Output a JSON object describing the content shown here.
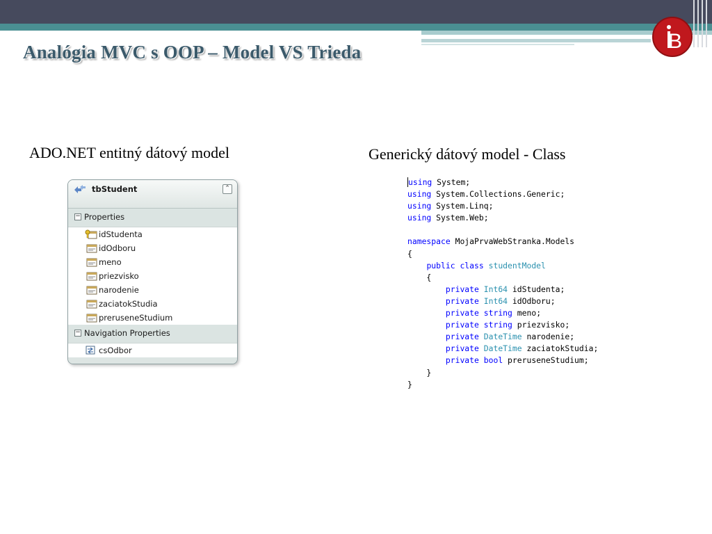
{
  "slide": {
    "title": "Analógia MVC s OOP – Model VS Trieda",
    "logo_letter": "B",
    "caption_left": "ADO.NET entitný dátový model",
    "caption_right": "Generický dátový model - Class"
  },
  "colors": {
    "header_dark": "#464a5d",
    "header_teal": "#4a8f92",
    "logo_red": "#c0181d",
    "title": "#3b5a6b",
    "code_keyword": "#0000ff",
    "code_type": "#2b91af"
  },
  "entity": {
    "name": "tbStudent",
    "collapse_glyph": "⌃",
    "sections": [
      {
        "title": "Properties",
        "items": [
          {
            "label": "idStudenta",
            "icon": "key-property-icon"
          },
          {
            "label": "idOdboru",
            "icon": "property-icon"
          },
          {
            "label": "meno",
            "icon": "property-icon"
          },
          {
            "label": "priezvisko",
            "icon": "property-icon"
          },
          {
            "label": "narodenie",
            "icon": "property-icon"
          },
          {
            "label": "zaciatokStudia",
            "icon": "property-icon"
          },
          {
            "label": "preruseneStudium",
            "icon": "property-icon"
          }
        ]
      },
      {
        "title": "Navigation Properties",
        "items": [
          {
            "label": "csOdbor",
            "icon": "navigation-property-icon"
          }
        ]
      }
    ]
  },
  "code": {
    "lines": [
      [
        [
          "kw",
          "using"
        ],
        [
          "t",
          " System;"
        ]
      ],
      [
        [
          "kw",
          "using"
        ],
        [
          "t",
          " System.Collections.Generic;"
        ]
      ],
      [
        [
          "kw",
          "using"
        ],
        [
          "t",
          " System.Linq;"
        ]
      ],
      [
        [
          "kw",
          "using"
        ],
        [
          "t",
          " System.Web;"
        ]
      ],
      [],
      [
        [
          "kw",
          "namespace"
        ],
        [
          "t",
          " MojaPrvaWebStranka.Models"
        ]
      ],
      [
        [
          "t",
          "{"
        ]
      ],
      [
        [
          "t",
          "    "
        ],
        [
          "kw",
          "public"
        ],
        [
          "t",
          " "
        ],
        [
          "kw",
          "class"
        ],
        [
          "t",
          " "
        ],
        [
          "ty",
          "studentModel"
        ]
      ],
      [
        [
          "t",
          "    {"
        ]
      ],
      [
        [
          "t",
          "        "
        ],
        [
          "kw",
          "private"
        ],
        [
          "t",
          " "
        ],
        [
          "ty",
          "Int64"
        ],
        [
          "t",
          " idStudenta;"
        ]
      ],
      [
        [
          "t",
          "        "
        ],
        [
          "kw",
          "private"
        ],
        [
          "t",
          " "
        ],
        [
          "ty",
          "Int64"
        ],
        [
          "t",
          " idOdboru;"
        ]
      ],
      [
        [
          "t",
          "        "
        ],
        [
          "kw",
          "private"
        ],
        [
          "t",
          " "
        ],
        [
          "kw",
          "string"
        ],
        [
          "t",
          " meno;"
        ]
      ],
      [
        [
          "t",
          "        "
        ],
        [
          "kw",
          "private"
        ],
        [
          "t",
          " "
        ],
        [
          "kw",
          "string"
        ],
        [
          "t",
          " priezvisko;"
        ]
      ],
      [
        [
          "t",
          "        "
        ],
        [
          "kw",
          "private"
        ],
        [
          "t",
          " "
        ],
        [
          "ty",
          "DateTime"
        ],
        [
          "t",
          " narodenie;"
        ]
      ],
      [
        [
          "t",
          "        "
        ],
        [
          "kw",
          "private"
        ],
        [
          "t",
          " "
        ],
        [
          "ty",
          "DateTime"
        ],
        [
          "t",
          " zaciatokStudia;"
        ]
      ],
      [
        [
          "t",
          "        "
        ],
        [
          "kw",
          "private"
        ],
        [
          "t",
          " "
        ],
        [
          "kw",
          "bool"
        ],
        [
          "t",
          " preruseneStudium;"
        ]
      ],
      [
        [
          "t",
          "    }"
        ]
      ],
      [
        [
          "t",
          "}"
        ]
      ]
    ]
  }
}
